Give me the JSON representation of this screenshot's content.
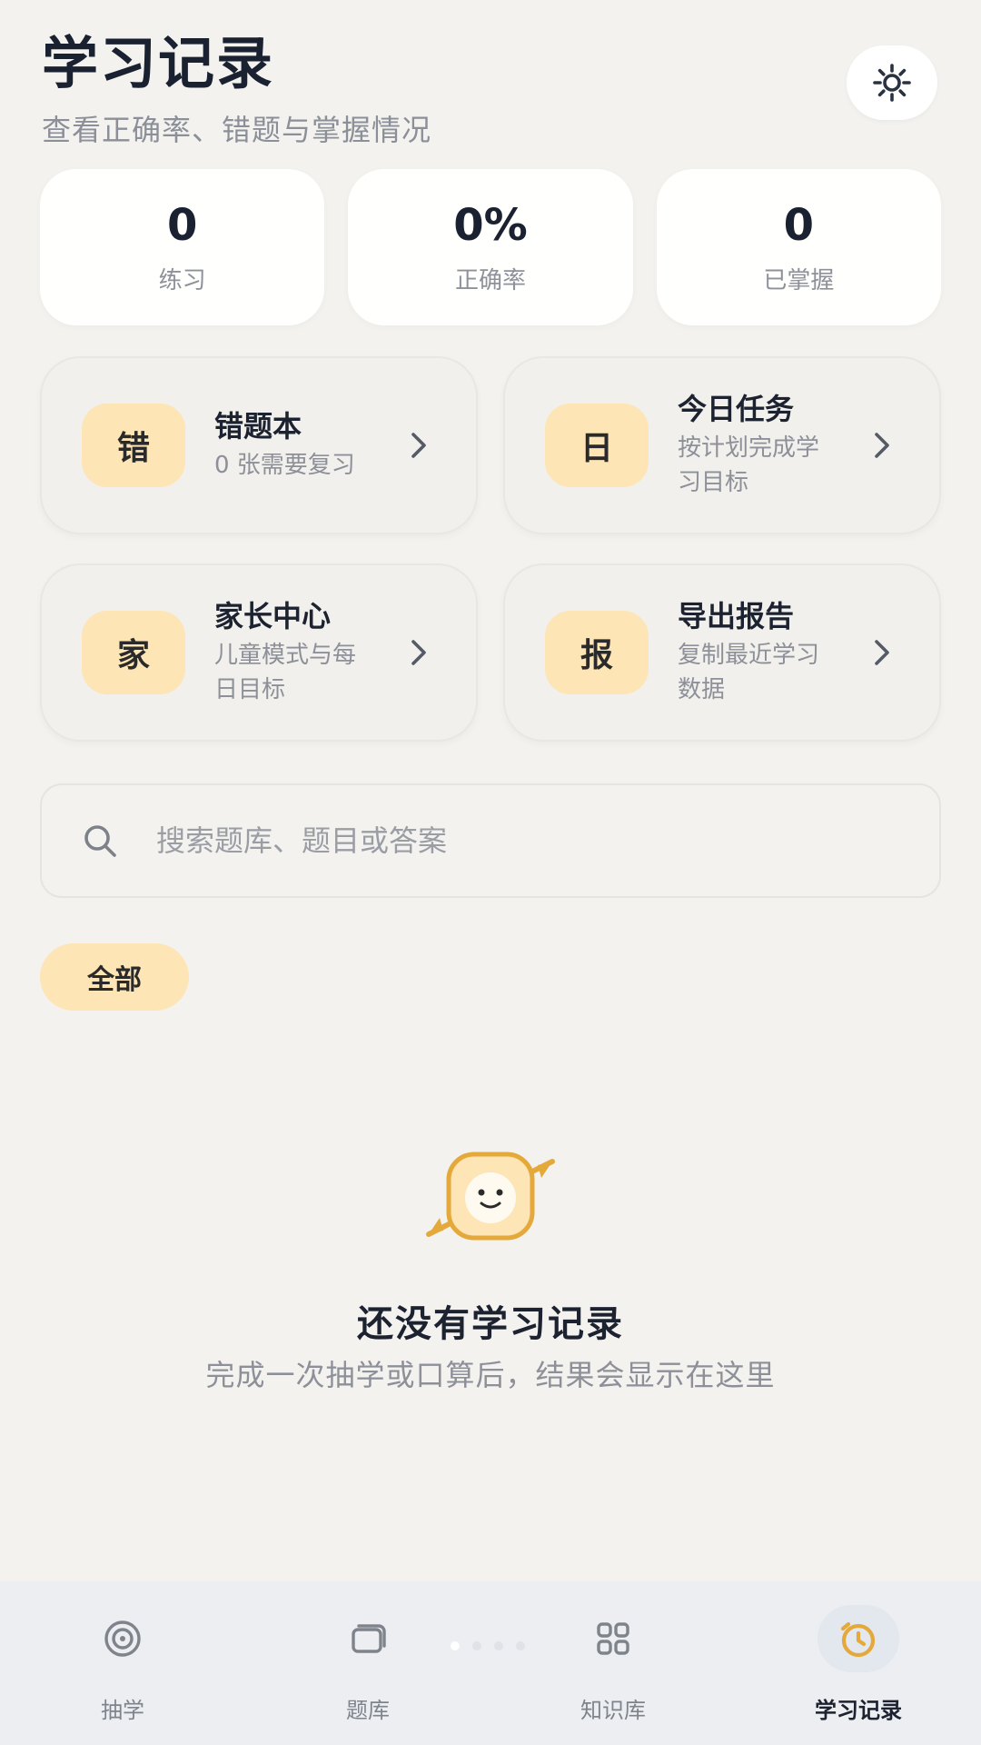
{
  "header": {
    "title": "学习记录",
    "subtitle": "查看正确率、错题与掌握情况",
    "settings_icon": "gear-icon"
  },
  "stats": [
    {
      "value": "0",
      "label": "练习"
    },
    {
      "value": "0%",
      "label": "正确率"
    },
    {
      "value": "0",
      "label": "已掌握"
    }
  ],
  "features": [
    {
      "badge": "错",
      "title": "错题本",
      "desc": "0 张需要复习"
    },
    {
      "badge": "日",
      "title": "今日任务",
      "desc": "按计划完成学习目标"
    },
    {
      "badge": "家",
      "title": "家长中心",
      "desc": "儿童模式与每日目标"
    },
    {
      "badge": "报",
      "title": "导出报告",
      "desc": "复制最近学习数据"
    }
  ],
  "search": {
    "placeholder": "搜索题库、题目或答案",
    "value": ""
  },
  "filter": {
    "selected": "全部"
  },
  "empty_state": {
    "title": "还没有学习记录",
    "description": "完成一次抽学或口算后，结果会显示在这里"
  },
  "bottom_nav": [
    {
      "label": "抽学",
      "icon": "target-icon",
      "active": false
    },
    {
      "label": "题库",
      "icon": "cards-icon",
      "active": false
    },
    {
      "label": "知识库",
      "icon": "grid-icon",
      "active": false
    },
    {
      "label": "学习记录",
      "icon": "clock-icon",
      "active": true
    }
  ],
  "colors": {
    "background": "#f3f2ef",
    "accent": "#fde5b5",
    "accent_icon": "#e4a93a",
    "text_primary": "#1c2230",
    "text_secondary": "#8d9098"
  }
}
